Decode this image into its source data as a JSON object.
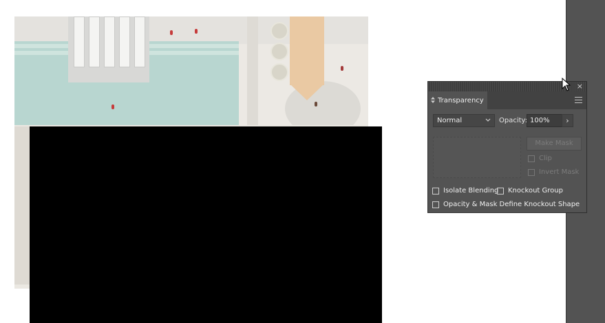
{
  "panel": {
    "tab_label": "Transparency",
    "close_glyph": "×",
    "blend_mode": "Normal",
    "opacity_label": "Opacity:",
    "opacity_value": "100%",
    "opacity_arrow": "›",
    "make_mask_label": "Make Mask",
    "clip_label": "Clip",
    "invert_mask_label": "Invert Mask",
    "isolate_blending_label": "Isolate Blending",
    "knockout_group_label": "Knockout Group",
    "opacity_mask_knockout_label": "Opacity & Mask Define Knockout Shape"
  },
  "icons": {
    "tab_collapse": "updown-arrows-icon",
    "panel_menu": "hamburger-menu-icon",
    "close": "close-icon",
    "blend_dropdown": "chevron-down-icon",
    "cursor": "arrow-cursor-icon"
  },
  "colors": {
    "panel_bg": "#535353",
    "panel_dark": "#424242",
    "canvas_bg": "#ffffff",
    "pool": "#b8d6d0",
    "roof": "#eac9a3"
  }
}
